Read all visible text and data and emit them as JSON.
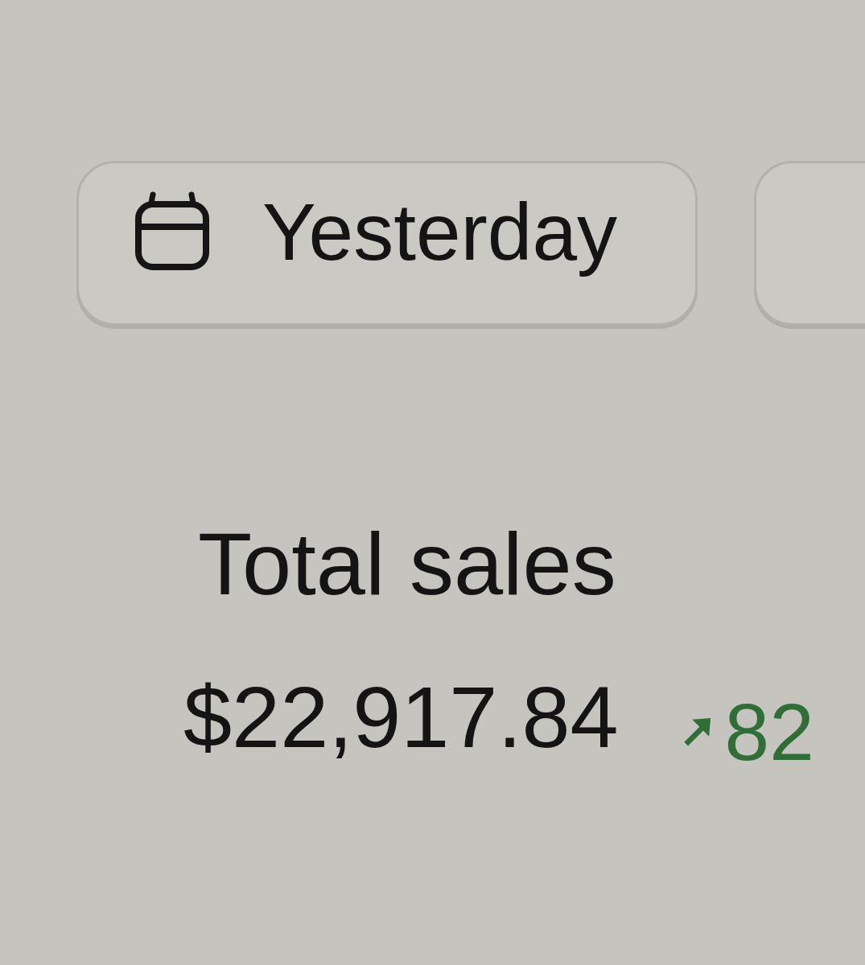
{
  "filters": [
    {
      "kind": "date",
      "label": "Yesterday"
    },
    {
      "kind": "plain"
    }
  ],
  "metric": {
    "title": "Total sales",
    "value": "$22,917.84",
    "change": {
      "increase": true,
      "text": "82"
    }
  }
}
